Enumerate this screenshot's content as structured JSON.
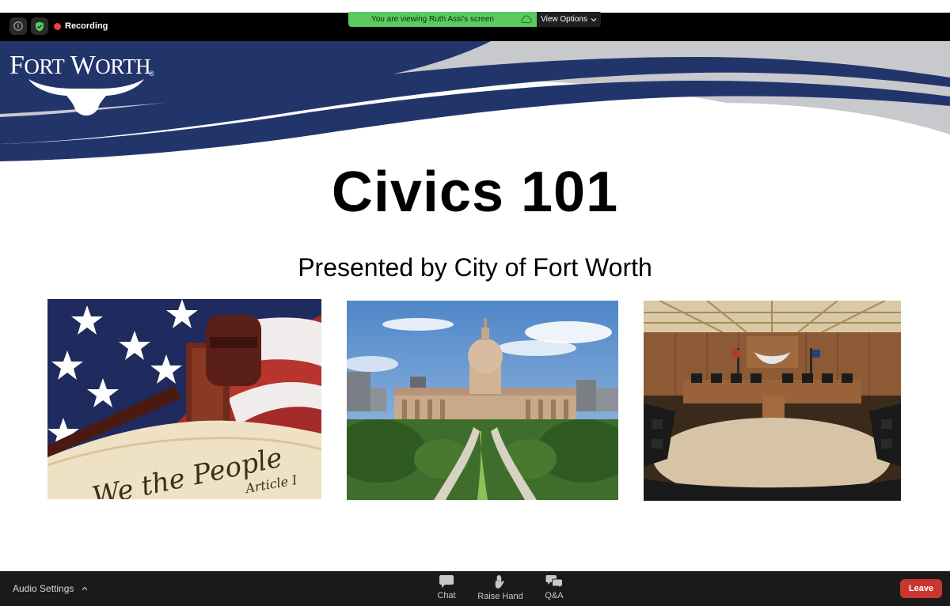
{
  "top_bar": {
    "recording_label": "Recording"
  },
  "share_banner": {
    "text": "You are viewing Ruth Assi's screen",
    "view_options_label": "View Options"
  },
  "slide": {
    "logo_text_f": "F",
    "logo_text_ort": "ORT",
    "logo_text_w": "W",
    "logo_text_orth": "ORTH",
    "title": "Civics 101",
    "subtitle": "Presented by City of Fort Worth",
    "photo_1_text": "We the People",
    "photo_1_caption": "Article I"
  },
  "bottom_bar": {
    "audio_settings_label": "Audio Settings",
    "chat_label": "Chat",
    "raise_hand_label": "Raise Hand",
    "qa_label": "Q&A",
    "leave_label": "Leave"
  },
  "colors": {
    "banner_green": "#5ccb5f",
    "slide_navy": "#22356b",
    "leave_red": "#c8362f"
  }
}
